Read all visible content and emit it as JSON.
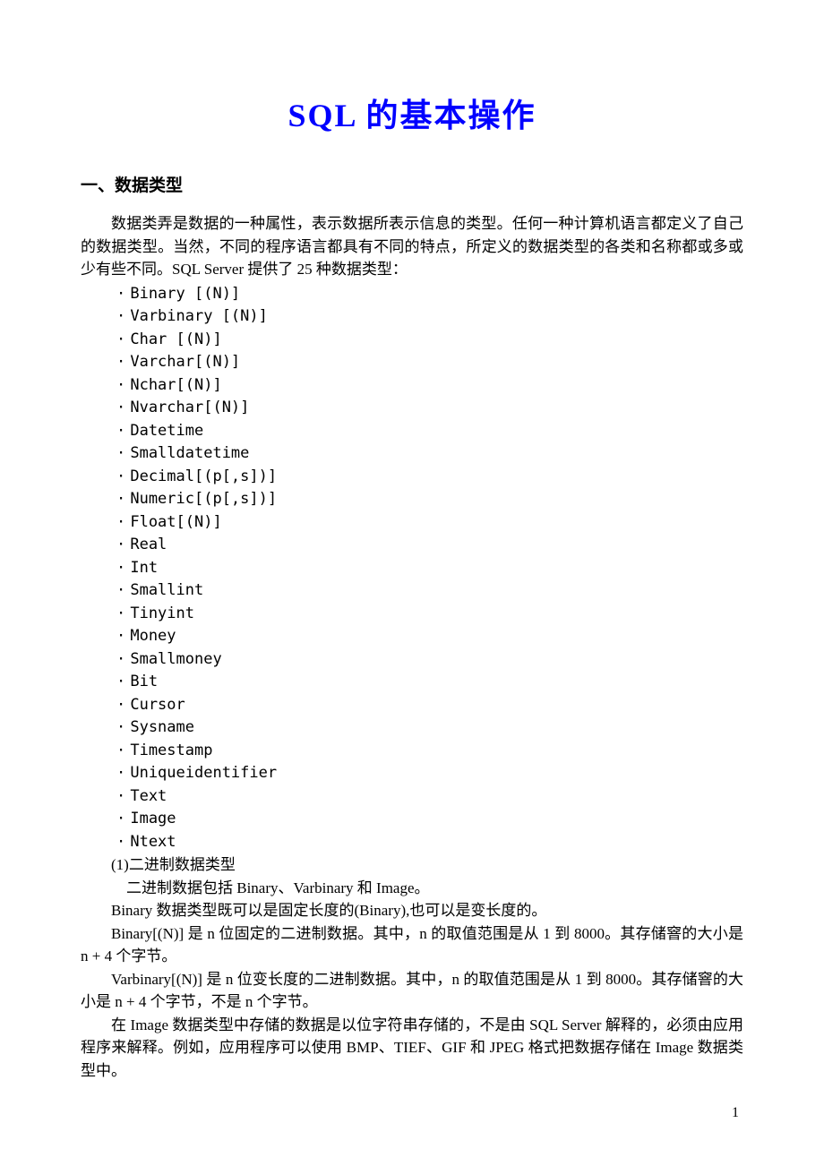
{
  "title": "SQL 的基本操作",
  "section_heading": "一、数据类型",
  "intro_paragraph": "数据类弄是数据的一种属性，表示数据所表示信息的类型。任何一种计算机语言都定义了自己的数据类型。当然，不同的程序语言都具有不同的特点，所定义的数据类型的各类和名称都或多或少有些不同。SQL Server 提供了 25 种数据类型：",
  "data_types": [
    "Binary [(N)]",
    "Varbinary [(N)]",
    "Char [(N)]",
    "Varchar[(N)]",
    "Nchar[(N)]",
    "Nvarchar[(N)]",
    "Datetime",
    "Smalldatetime",
    "Decimal[(p[,s])]",
    "Numeric[(p[,s])]",
    "Float[(N)]",
    "Real",
    "Int",
    "Smallint",
    "Tinyint",
    "Money",
    "Smallmoney",
    "Bit",
    "Cursor",
    "Sysname",
    "Timestamp",
    "Uniqueidentifier",
    "Text",
    "Image",
    "Ntext"
  ],
  "subsection_heading": "(1)二进制数据类型",
  "subsection_intro": "二进制数据包括 Binary、Varbinary 和 Image。",
  "binary_para1": "Binary 数据类型既可以是固定长度的(Binary),也可以是变长度的。",
  "binary_para2": "Binary[(N)] 是 n 位固定的二进制数据。其中，n 的取值范围是从 1 到 8000。其存储窨的大小是 n + 4 个字节。",
  "varbinary_para": "Varbinary[(N)] 是 n 位变长度的二进制数据。其中，n 的取值范围是从 1 到 8000。其存储窨的大小是 n + 4 个字节，不是 n 个字节。",
  "image_para": "在 Image 数据类型中存储的数据是以位字符串存储的，不是由 SQL Server 解释的，必须由应用程序来解释。例如，应用程序可以使用 BMP、TIEF、GIF 和 JPEG 格式把数据存储在 Image 数据类型中。",
  "page_number": "1"
}
